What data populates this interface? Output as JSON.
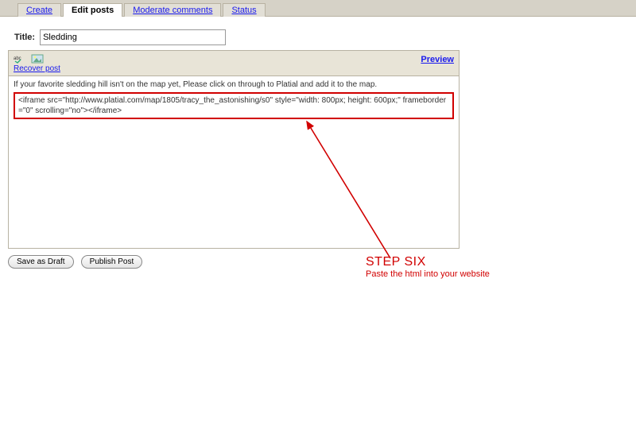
{
  "tabs": {
    "create": "Create",
    "edit": "Edit posts",
    "moderate": "Moderate comments",
    "status": "Status"
  },
  "title": {
    "label": "Title:",
    "value": "Sledding"
  },
  "toolbar": {
    "recover": "Recover post",
    "preview": "Preview",
    "spellcheck_icon": "spellcheck-icon",
    "image_icon": "image-icon"
  },
  "editor": {
    "intro": "If your favorite sledding hill isn't on the map yet, Please click on through to Platial and add it to the map.",
    "code": "<iframe src=\"http://www.platial.com/map/1805/tracy_the_astonishing/s0\" style=\"width: 800px; height: 600px;\" frameborder=\"0\" scrolling=\"no\"></iframe>"
  },
  "buttons": {
    "draft": "Save as Draft",
    "publish": "Publish Post"
  },
  "annotation": {
    "title": "STEP SIX",
    "sub": "Paste the html into your website"
  },
  "colors": {
    "annotation": "#d10000"
  }
}
